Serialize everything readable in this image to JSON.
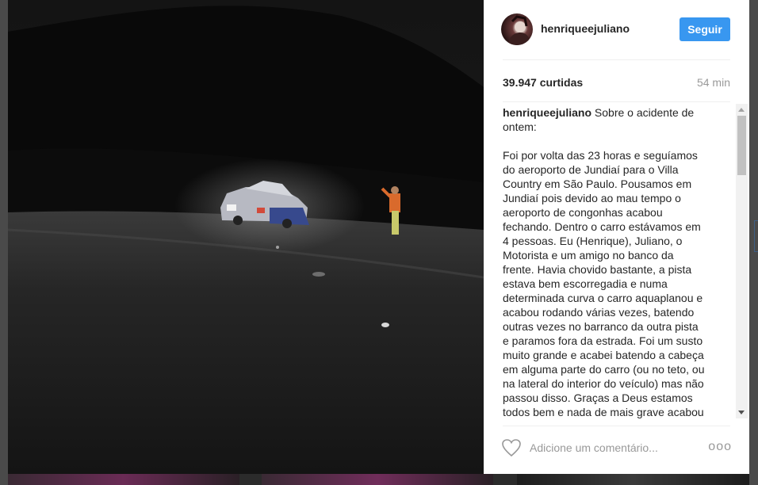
{
  "post": {
    "username": "henriqueejuliano",
    "follow_label": "Seguir",
    "likes": "39.947 curtidas",
    "time_ago": "54 min",
    "caption_author": "henriqueejuliano",
    "caption_text": " Sobre o acidente de\nontem:\n\nFoi por volta das 23 horas e seguíamos\ndo aeroporto de Jundiaí para o Villa\nCountry em São Paulo. Pousamos em\nJundiaí pois devido ao mau tempo o\naeroporto de congonhas acabou\nfechando. Dentro o carro estávamos em\n4 pessoas. Eu (Henrique), Juliano, o\nMotorista e um amigo no banco da\nfrente. Havia chovido bastante, a pista\nestava bem escorregadia e numa\ndeterminada curva o carro aquaplanou e\nacabou rodando várias vezes, batendo\noutras vezes no barranco da outra pista\ne paramos fora da estrada. Foi um susto\nmuito grande e acabei batendo a cabeça\nem alguma parte do carro (ou no teto, ou\nna lateral do interior do veículo) mas não\npassou disso. Graças a Deus estamos\ntodos bem e nada de mais grave acabou",
    "comment_placeholder": "Adicione um comentário...",
    "more_glyph": "ooo"
  },
  "icons": {
    "like": "heart-outline-icon",
    "options": "more-options-icon"
  },
  "colors": {
    "follow_button": "#3897f0",
    "text": "#262626",
    "muted": "#999999"
  }
}
